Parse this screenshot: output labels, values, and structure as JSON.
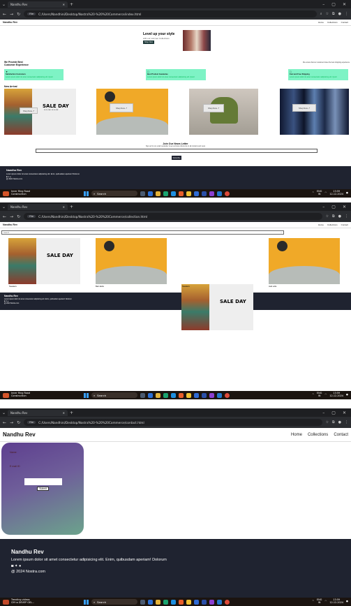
{
  "tabs": {
    "title": "Nandhu Rev"
  },
  "browser": {
    "file_pill": "File",
    "url_index": "C:/Users/Nandhini/Desktop/Nostra%20-%20%20Commerce/index.html",
    "url_collection": "C:/Users/Nandhini/Desktop/Nostra%20-%20%20Commerce/collection.html",
    "url_contact": "C:/Users/Nandhini/Desktop/Nostra%20-%20%20Commerce/contact.html"
  },
  "site": {
    "logo": "Nandhu Rev",
    "nav": [
      "Home",
      "Collections",
      "Contact"
    ]
  },
  "home": {
    "hero_title": "Level up your style",
    "hero_sub": "with our summer Collections",
    "hero_btn": "Shop Now",
    "about_title_1": "We Provide Best",
    "about_title_2": "Customer Experience",
    "about_side": "We ensure that our customers have the best shopping experience",
    "features": [
      {
        "icon": "▼",
        "title": "Satisfaction Customers",
        "text": "Lorem ipsum dolor sit amet consectetur adipisicing elit. Quod"
      },
      {
        "icon": "☐",
        "title": "Best Product Guarantee",
        "text": "Lorem ipsum dolor sit amet consectetur adipisicing elit. Quod"
      },
      {
        "icon": "☐",
        "title": "Fast and Free Shipping",
        "text": "Lorem ipsum dolor sit amet consectetur adipisicing elit. Quod"
      }
    ],
    "new_arrival_title": "New Arrival",
    "arrival_buttons": [
      "Shop Now ↗",
      "Shop Now ↗",
      "Shop Now ↗",
      "Shop Now ↗"
    ],
    "newsletter_title": "Join Our News Letter",
    "newsletter_sub": "Sign up for our email newsletter to get exclusive discounts on all products and news",
    "newsletter_btn": "Subscribe",
    "sale_text_1": "SALE DAY",
    "sale_text_2": "15 % OFF, 15 % OFF"
  },
  "collection": {
    "search_placeholder": "Search",
    "items": [
      "Sweaters",
      "Bad Jacks",
      "Sweaters",
      "Jack ucks"
    ]
  },
  "contact": {
    "name_label": "Name",
    "email_label": "E mail ID",
    "submit": "Submit"
  },
  "footer": {
    "name": "Nandhu Rev",
    "text": "Lorem ipsum dolor sit amet consectetur adipisicing elit. Enim, quibusdam aperiam! Dolorum",
    "social": "◙ ✦ ●",
    "copy": "@ 2024 Nostra.com"
  },
  "taskbar": {
    "weather_1": "Inner Ring Road",
    "weather_1b": "Construction",
    "weather_3": "Trending videos",
    "weather_3b": "CM to DEVEP GEL...",
    "search": "Search",
    "lang": "ENG",
    "lang_sub": "IN",
    "time": "13:59",
    "date": "12-12-2024"
  },
  "colors": {
    "chrome_dark": "#1e1f22",
    "footer_bg": "#1f2330",
    "feature_green": "#7ef3c5",
    "form_gradient_top": "#5e3f8f",
    "form_gradient_bottom": "#6ca38c"
  }
}
